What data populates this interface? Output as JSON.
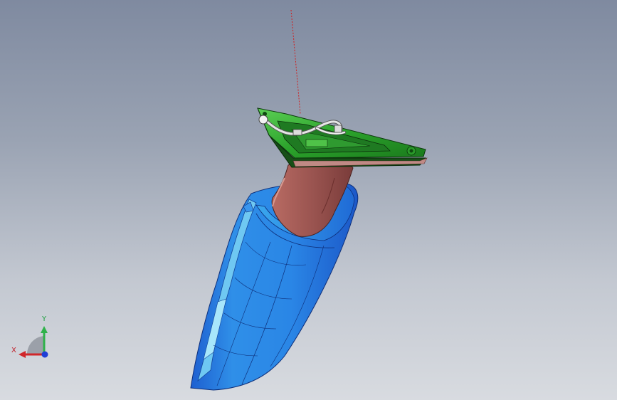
{
  "app": "CAD 3D viewport",
  "triad": {
    "x_label": "X",
    "y_label": "Y",
    "colors": {
      "x": "#d0262a",
      "y": "#2fb24a",
      "z": "#1f3fd6"
    }
  },
  "model": {
    "parts": [
      "mount-plate",
      "wiring-harness",
      "mirror-arm",
      "mirror-housing"
    ],
    "colors": {
      "housing": "#2a86e6",
      "housing_highlight": "#7fd2f4",
      "arm": "#9a5450",
      "plate": "#1f8a22",
      "plate_light": "#4fc248",
      "harness": "#d9d9d9"
    }
  },
  "background": {
    "top": "#7f8aa0",
    "bottom": "#d8dbe0"
  }
}
